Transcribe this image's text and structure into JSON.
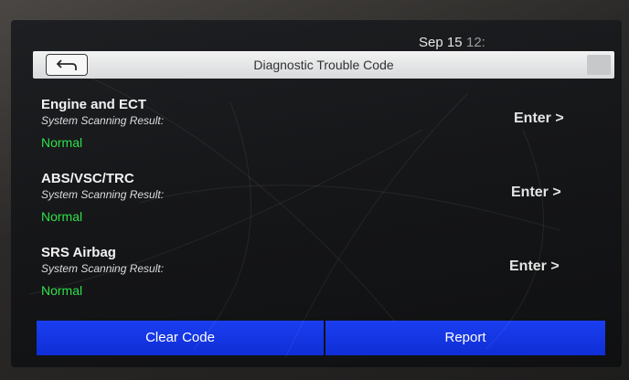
{
  "statusbar": {
    "date": "Sep 15",
    "time": "12:"
  },
  "header": {
    "title": "Diagnostic Trouble Code"
  },
  "systems": [
    {
      "name": "Engine and ECT",
      "subtitle": "System Scanning Result:",
      "status": "Normal",
      "action": "Enter >"
    },
    {
      "name": "ABS/VSC/TRC",
      "subtitle": "System Scanning Result:",
      "status": "Normal",
      "action": "Enter >"
    },
    {
      "name": "SRS Airbag",
      "subtitle": "System Scanning Result:",
      "status": "Normal",
      "action": "Enter >"
    }
  ],
  "buttons": {
    "clear": "Clear Code",
    "report": "Report"
  },
  "colors": {
    "accent": "#1a3ef0",
    "status_ok": "#2fe04a",
    "header_bg": "#e4e6e8"
  },
  "icons": {
    "back": "back-arrow-icon",
    "menu": "menu-icon"
  }
}
